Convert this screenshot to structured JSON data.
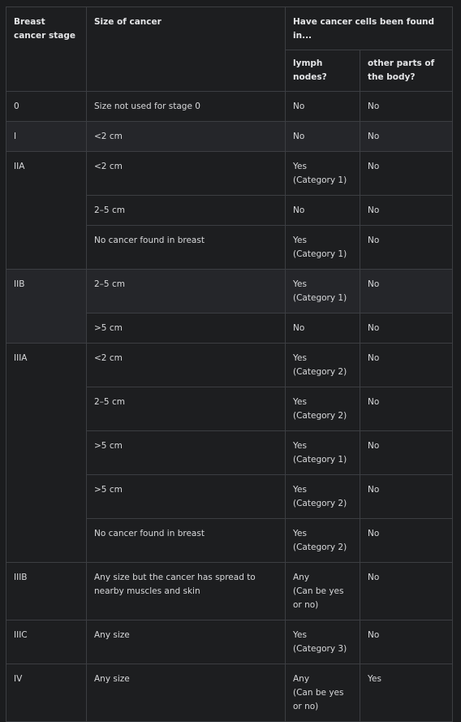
{
  "header": {
    "stage": "Breast cancer stage",
    "size": "Size of cancer",
    "found": "Have cancer cells been found in...",
    "lymph": "lymph nodes?",
    "other": "other parts of the body?"
  },
  "rows": [
    {
      "stage": "0",
      "size": "Size not used for stage 0",
      "lymph": "No",
      "other": "No"
    },
    {
      "stage": "I",
      "size": "<2 cm",
      "lymph": "No",
      "other": "No"
    },
    {
      "stage": "IIA",
      "size": "<2 cm",
      "lymph": "Yes\n(Category 1)",
      "other": "No"
    },
    {
      "size": "2–5 cm",
      "lymph": "No",
      "other": "No"
    },
    {
      "size": "No cancer found in breast",
      "lymph": "Yes\n(Category 1)",
      "other": "No"
    },
    {
      "stage": "IIB",
      "size": "2–5 cm",
      "lymph": "Yes\n(Category 1)",
      "other": "No"
    },
    {
      "size": ">5 cm",
      "lymph": "No",
      "other": "No"
    },
    {
      "stage": "IIIA",
      "size": "<2 cm",
      "lymph": "Yes\n(Category 2)",
      "other": "No"
    },
    {
      "size": "2–5 cm",
      "lymph": "Yes\n(Category 2)",
      "other": "No"
    },
    {
      "size": ">5 cm",
      "lymph": "Yes\n(Category 1)",
      "other": "No"
    },
    {
      "size": ">5 cm",
      "lymph": "Yes\n(Category 2)",
      "other": "No"
    },
    {
      "size": "No cancer found in breast",
      "lymph": "Yes\n(Category 2)",
      "other": "No"
    },
    {
      "stage": "IIIB",
      "size": "Any size but the cancer has spread to nearby muscles and skin",
      "lymph": "Any\n(Can be yes or no)",
      "other": "No"
    },
    {
      "stage": "IIIC",
      "size": "Any size",
      "lymph": "Yes\n(Category 3)",
      "other": "No"
    },
    {
      "stage": "IV",
      "size": "Any size",
      "lymph": "Any\n(Can be yes or no)",
      "other": "Yes"
    }
  ]
}
